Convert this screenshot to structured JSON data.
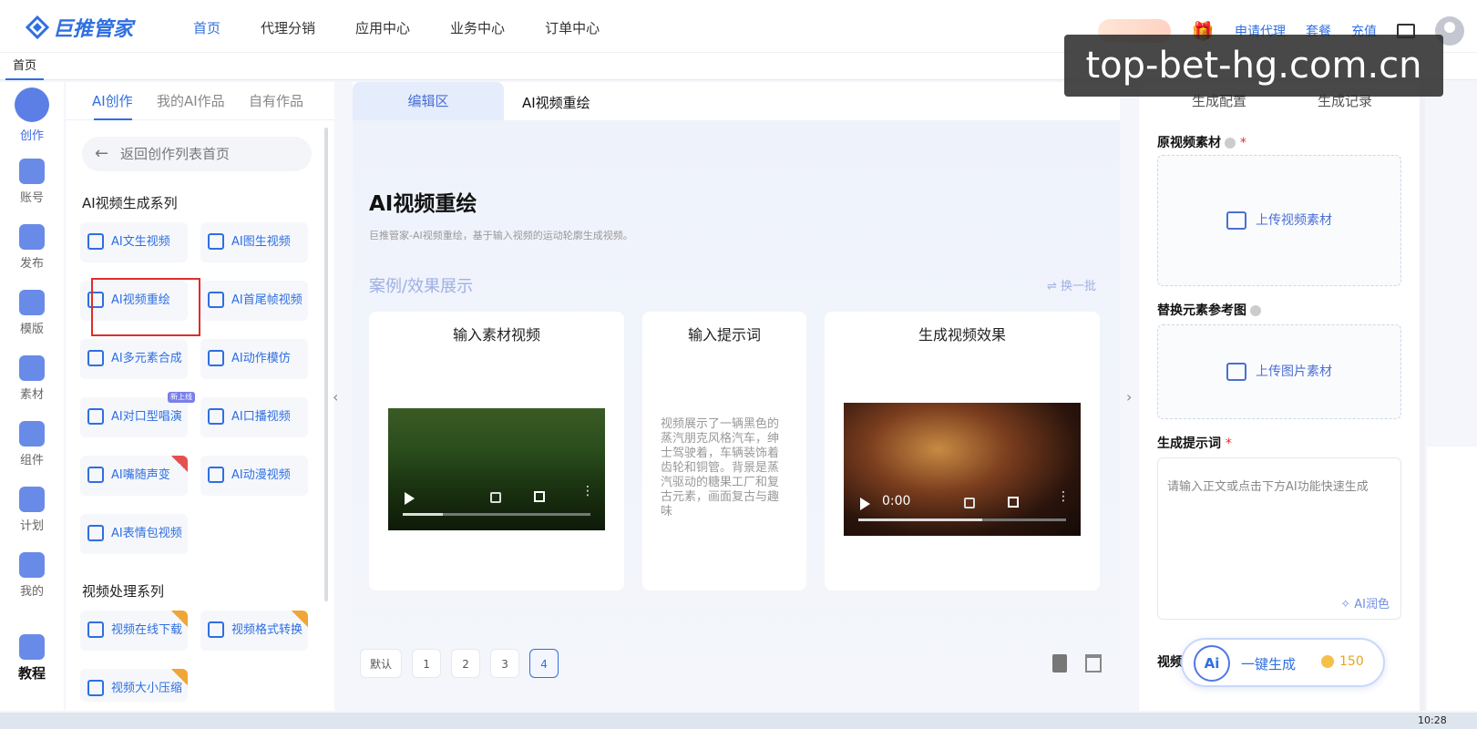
{
  "app": {
    "logo_text": "巨推管家"
  },
  "nav": {
    "items": [
      "首页",
      "代理分销",
      "应用中心",
      "业务中心",
      "订单中心"
    ],
    "active": 0
  },
  "header_right": {
    "links": [
      "申请代理",
      "套餐",
      "充值"
    ]
  },
  "watermark": "top-bet-hg.com.cn",
  "tabstrip": {
    "current": "首页"
  },
  "rail": {
    "items": [
      "创作",
      "账号",
      "发布",
      "模版",
      "素材",
      "组件",
      "计划",
      "我的",
      "教程"
    ]
  },
  "left_panel": {
    "tabs": [
      "AI创作",
      "我的AI作品",
      "自有作品"
    ],
    "back_label": "返回创作列表首页",
    "ai_series_title": "AI视频生成系列",
    "ai_buttons": [
      "AI文生视频",
      "AI图生视频",
      "AI视频重绘",
      "AI首尾帧视频",
      "AI多元素合成",
      "AI动作模仿",
      "AI对口型唱演",
      "AI口播视频",
      "AI嘴随声变",
      "AI动漫视频",
      "AI表情包视频"
    ],
    "new_badge": "新上线",
    "proc_series_title": "视频处理系列",
    "proc_buttons": [
      "视频在线下载",
      "视频格式转换",
      "视频大小压缩"
    ]
  },
  "center": {
    "tab_edit": "编辑区",
    "tab_name": "AI视频重绘",
    "title": "AI视频重绘",
    "description": "巨推管家-AI视频重绘，基于输入视频的运动轮廓生成视频。",
    "case_title": "案例/效果展示",
    "swap_label": "⇌ 换一批",
    "cards": {
      "input_video": "输入素材视频",
      "input_prompt": "输入提示词",
      "output_video": "生成视频效果"
    },
    "prompt_text": "视频展示了一辆黑色的蒸汽朋克风格汽车，绅士驾驶着，车辆装饰着齿轮和铜管。背景是蒸汽驱动的糖果工厂和复古元素，画面复古与趣味",
    "output_time": "0:00",
    "pager": [
      "默认",
      "1",
      "2",
      "3",
      "4"
    ],
    "active_page": "4"
  },
  "right_panel": {
    "tabs": [
      "生成配置",
      "生成记录"
    ],
    "source_label": "原视频素材",
    "upload_video": "上传视频素材",
    "ref_label": "替换元素参考图",
    "upload_image": "上传图片素材",
    "prompt_label": "生成提示词",
    "prompt_placeholder": "请输入正文或点击下方AI功能快速生成",
    "ai_polish": "AI润色",
    "clipped_label": "视频",
    "generate_label": "一键生成",
    "ai_badge": "Ai",
    "cost": "150"
  },
  "taskbar": {
    "time": "10:28"
  }
}
